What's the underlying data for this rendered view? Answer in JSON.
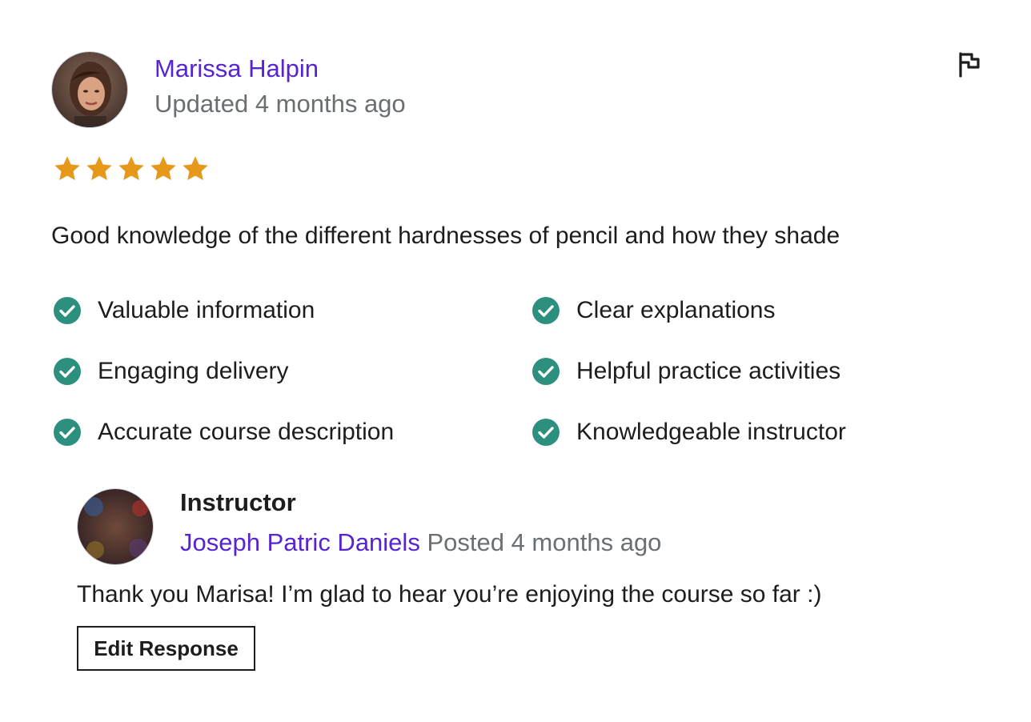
{
  "review": {
    "reviewer_name": "Marissa Halpin",
    "updated": "Updated 4 months ago",
    "rating": 5,
    "rating_max": 5,
    "text": "Good knowledge of the different hardnesses of pencil and how they shade",
    "features": [
      "Valuable information",
      "Clear explanations",
      "Engaging delivery",
      "Helpful practice activities",
      "Accurate course description",
      "Knowledgeable instructor"
    ]
  },
  "response": {
    "role_label": "Instructor",
    "instructor_name": "Joseph Patric Daniels",
    "posted": "Posted 4 months ago",
    "text": "Thank you Marisa! I’m glad to hear you’re enjoying the course so far :)",
    "edit_button_label": "Edit Response"
  },
  "icons": {
    "flag": "flag-icon",
    "star": "star-icon",
    "check": "check-circle-icon"
  },
  "colors": {
    "link": "#5624d0",
    "muted": "#6a6f73",
    "star": "#e59819",
    "check": "#2d907f",
    "text": "#1c1d1f"
  }
}
